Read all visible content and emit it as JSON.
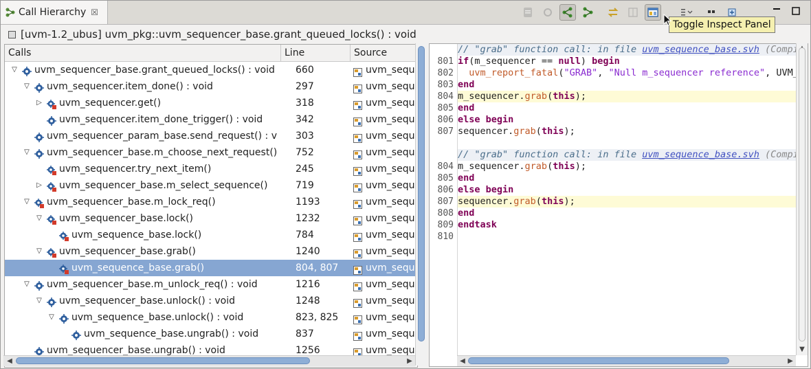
{
  "tab": {
    "title": "Call Hierarchy",
    "close_glyph": "☒"
  },
  "tooltip": "Toggle Inspect Panel",
  "header": "[uvm-1.2_ubus] uvm_pkg::uvm_sequencer_base.grant_queued_locks() :  void",
  "columns": {
    "calls": "Calls",
    "line": "Line",
    "source": "Source"
  },
  "rows": [
    {
      "depth": 0,
      "exp": "open",
      "label": "uvm_sequencer_base.grant_queued_locks() :  void",
      "line": "660",
      "source": "uvm_seque",
      "icon": "method-icon",
      "sel": false
    },
    {
      "depth": 1,
      "exp": "open",
      "label": "uvm_sequencer.item_done() :  void",
      "line": "297",
      "source": "uvm_seque",
      "icon": "method-icon",
      "sel": false
    },
    {
      "depth": 2,
      "exp": "closed",
      "label": "uvm_sequencer.get()",
      "line": "318",
      "source": "uvm_seque",
      "icon": "task-icon",
      "sel": false
    },
    {
      "depth": 2,
      "exp": "none",
      "label": "uvm_sequencer.item_done_trigger() :  void",
      "line": "342",
      "source": "uvm_seque",
      "icon": "method-icon",
      "sel": false
    },
    {
      "depth": 1,
      "exp": "none",
      "label": "uvm_sequencer_param_base.send_request() :  v",
      "line": "303",
      "source": "uvm_seque",
      "icon": "method-icon",
      "sel": false
    },
    {
      "depth": 1,
      "exp": "open",
      "label": "uvm_sequencer_base.m_choose_next_request()",
      "line": "752",
      "source": "uvm_seque",
      "icon": "method-icon",
      "sel": false
    },
    {
      "depth": 2,
      "exp": "none",
      "label": "uvm_sequencer.try_next_item()",
      "line": "245",
      "source": "uvm_seque",
      "icon": "task-icon",
      "sel": false
    },
    {
      "depth": 2,
      "exp": "closed",
      "label": "uvm_sequencer_base.m_select_sequence()",
      "line": "719",
      "source": "uvm_seque",
      "icon": "task-icon",
      "sel": false
    },
    {
      "depth": 1,
      "exp": "open",
      "label": "uvm_sequencer_base.m_lock_req()",
      "line": "1193",
      "source": "uvm_seque",
      "icon": "task-icon",
      "sel": false
    },
    {
      "depth": 2,
      "exp": "open",
      "label": "uvm_sequencer_base.lock()",
      "line": "1232",
      "source": "uvm_seque",
      "icon": "task-icon",
      "sel": false
    },
    {
      "depth": 3,
      "exp": "none",
      "label": "uvm_sequence_base.lock()",
      "line": "784",
      "source": "uvm_seque",
      "icon": "task-icon",
      "sel": false
    },
    {
      "depth": 2,
      "exp": "open",
      "label": "uvm_sequencer_base.grab()",
      "line": "1240",
      "source": "uvm_seque",
      "icon": "task-icon",
      "sel": false
    },
    {
      "depth": 3,
      "exp": "none",
      "label": "uvm_sequence_base.grab()",
      "line": "804, 807",
      "source": "uvm_seque",
      "icon": "task-icon",
      "sel": true
    },
    {
      "depth": 1,
      "exp": "open",
      "label": "uvm_sequencer_base.m_unlock_req() :  void",
      "line": "1216",
      "source": "uvm_seque",
      "icon": "method-icon",
      "sel": false
    },
    {
      "depth": 2,
      "exp": "open",
      "label": "uvm_sequencer_base.unlock() :  void",
      "line": "1248",
      "source": "uvm_seque",
      "icon": "method-icon",
      "sel": false
    },
    {
      "depth": 3,
      "exp": "open",
      "label": "uvm_sequence_base.unlock() :  void",
      "line": "823, 825",
      "source": "uvm_seque",
      "icon": "method-icon",
      "sel": false
    },
    {
      "depth": 4,
      "exp": "none",
      "label": "uvm_sequence_base.ungrab() :  void",
      "line": "837",
      "source": "uvm_seque",
      "icon": "method-icon",
      "sel": false
    },
    {
      "depth": 1,
      "exp": "none",
      "label": "uvm_sequencer_base.ungrab() :  void",
      "line": "1256",
      "source": "uvm_seque",
      "icon": "method-icon",
      "sel": false
    }
  ],
  "code": {
    "comment_prefix": "// \"grab\" function call: in file ",
    "comment_file": "uvm_sequence_base.svh",
    "comment_suffix": " (Compi",
    "block1": [
      {
        "n": "801",
        "segs": [
          [
            "kw",
            "if"
          ],
          [
            "",
            "(m_sequencer == "
          ],
          [
            "kw",
            "null"
          ],
          [
            "",
            ") "
          ],
          [
            "kw",
            "begin"
          ]
        ]
      },
      {
        "n": "802",
        "segs": [
          [
            "",
            "  "
          ],
          [
            "fn",
            "uvm_report_fatal"
          ],
          [
            "",
            "("
          ],
          [
            "str",
            "\"GRAB\""
          ],
          [
            "",
            ", "
          ],
          [
            "str",
            "\"Null m_sequencer reference\""
          ],
          [
            "",
            ", UVM_L"
          ]
        ]
      },
      {
        "n": "803",
        "segs": [
          [
            "kw",
            "end"
          ]
        ]
      },
      {
        "n": "804",
        "hl": true,
        "segs": [
          [
            "",
            "m_sequencer."
          ],
          [
            "fn",
            "grab"
          ],
          [
            "",
            "("
          ],
          [
            "kw",
            "this"
          ],
          [
            "",
            ");"
          ]
        ]
      },
      {
        "n": "805",
        "segs": [
          [
            "kw",
            "end"
          ]
        ]
      },
      {
        "n": "806",
        "segs": [
          [
            "kw",
            "else begin"
          ]
        ]
      },
      {
        "n": "807",
        "segs": [
          [
            "",
            "sequencer."
          ],
          [
            "fn",
            "grab"
          ],
          [
            "",
            "("
          ],
          [
            "kw",
            "this"
          ],
          [
            "",
            ");"
          ]
        ]
      }
    ],
    "block2": [
      {
        "n": "804",
        "segs": [
          [
            "",
            "m_sequencer."
          ],
          [
            "fn",
            "grab"
          ],
          [
            "",
            "("
          ],
          [
            "kw",
            "this"
          ],
          [
            "",
            ");"
          ]
        ]
      },
      {
        "n": "805",
        "segs": [
          [
            "kw",
            "end"
          ]
        ]
      },
      {
        "n": "806",
        "segs": [
          [
            "kw",
            "else begin"
          ]
        ]
      },
      {
        "n": "807",
        "hl": true,
        "segs": [
          [
            "",
            "sequencer."
          ],
          [
            "fn",
            "grab"
          ],
          [
            "",
            "("
          ],
          [
            "kw",
            "this"
          ],
          [
            "",
            ");"
          ]
        ]
      },
      {
        "n": "808",
        "segs": [
          [
            "kw",
            "end"
          ]
        ]
      },
      {
        "n": "809",
        "segs": [
          [
            "kw",
            "endtask"
          ]
        ]
      },
      {
        "n": "810",
        "segs": []
      }
    ]
  },
  "colors": {
    "selection": "#86a6d2",
    "keyword": "#7f0055",
    "highlight_line": "#fefbd6",
    "tooltip_bg": "#f5f0b0"
  }
}
